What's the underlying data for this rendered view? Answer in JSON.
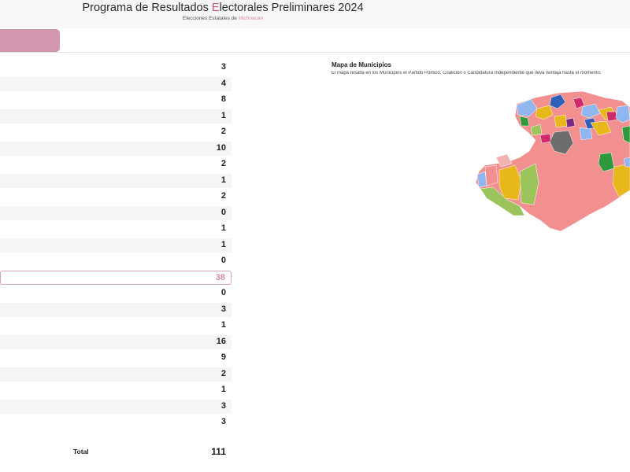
{
  "header": {
    "title_part1": "Programa de Resultados ",
    "title_accent": "E",
    "title_part2": "lectorales Preliminares 2024",
    "subtitle_part1": "Elecciones Estatales de ",
    "subtitle_accent": "Michoacán"
  },
  "table": {
    "rows": [
      {
        "value": "3"
      },
      {
        "value": "4"
      },
      {
        "value": "8"
      },
      {
        "value": "1"
      },
      {
        "value": "2"
      },
      {
        "value": "10"
      },
      {
        "value": "2"
      },
      {
        "value": "1"
      },
      {
        "value": "2"
      },
      {
        "value": "0"
      },
      {
        "value": "1"
      },
      {
        "value": "1"
      },
      {
        "value": "0"
      },
      {
        "value": "38",
        "highlight": true
      },
      {
        "value": "0"
      },
      {
        "value": "3"
      },
      {
        "value": "1"
      },
      {
        "value": "16"
      },
      {
        "value": "9"
      },
      {
        "value": "2"
      },
      {
        "value": "1"
      },
      {
        "value": "3"
      },
      {
        "value": "3"
      }
    ],
    "total_label": "Total",
    "total_value": "111"
  },
  "map": {
    "title": "Mapa de Municipios",
    "description": "El mapa resalta en los Municipios el Partido Político, Coalición o Candidatura Independiente que lleva ventaja hasta el momento.",
    "colors": {
      "majority": "#f28f8f",
      "blue_light": "#8fb6f0",
      "blue_dark": "#2f5fb8",
      "yellow": "#e8b71a",
      "green_light": "#9bc45a",
      "green_dark": "#2f9a3c",
      "gray": "#6d6d6d",
      "purple": "#7b2a84",
      "magenta": "#d02a6a",
      "pink_light": "#f4b2b2"
    }
  }
}
